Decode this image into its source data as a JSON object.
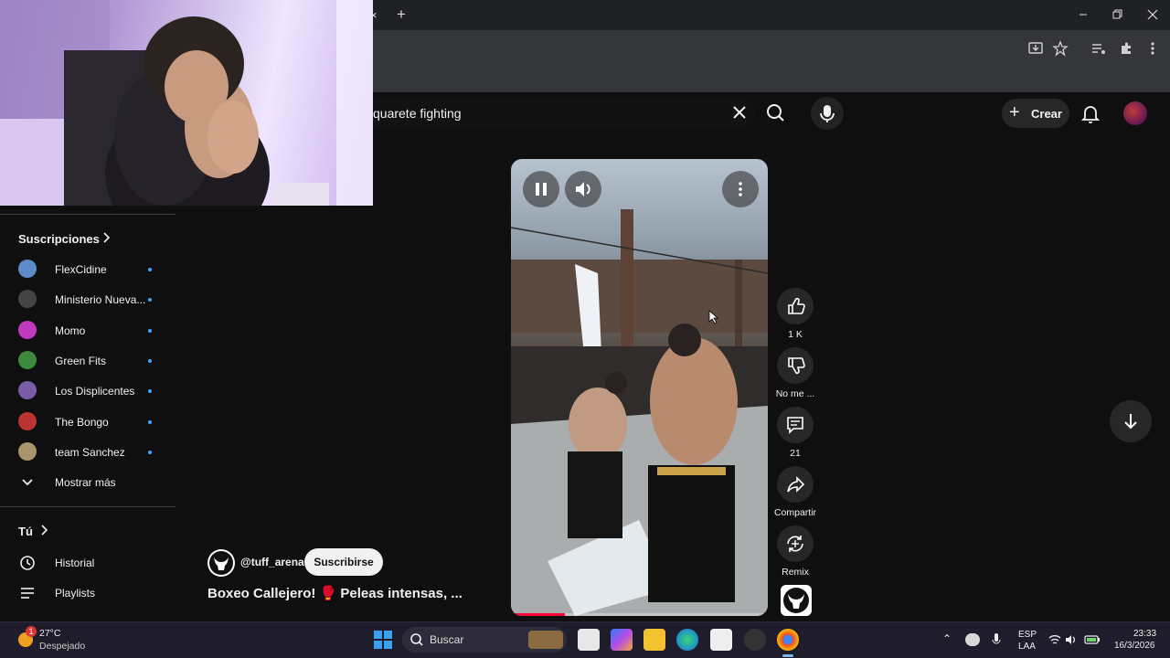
{
  "browser": {
    "new_tab_symbol": "+",
    "close_tab_symbol": "×",
    "window_controls": [
      "minimize-icon",
      "restore-icon",
      "close-icon"
    ],
    "toolbar_icons": [
      "install-app-icon",
      "bookmark-star-icon",
      "media-control-icon",
      "extensions-icon",
      "kebab-menu-icon"
    ]
  },
  "header": {
    "search_value": "quarete fighting",
    "create_label": "Crear"
  },
  "sidebar": {
    "subscriptions_label": "Suscripciones",
    "subscriptions": [
      {
        "name": "FlexCidine",
        "color": "#5b8cc7"
      },
      {
        "name": "Ministerio Nueva...",
        "color": "#444444"
      },
      {
        "name": "Momo",
        "color": "#c03ac0"
      },
      {
        "name": "Green Fits",
        "color": "#3d8a3d"
      },
      {
        "name": "Los Displicentes",
        "color": "#7a5ca8"
      },
      {
        "name": "The Bongo",
        "color": "#b33"
      },
      {
        "name": "team Sanchez",
        "color": "#a8956b"
      }
    ],
    "show_more_label": "Mostrar más",
    "you_label": "Tú",
    "history_label": "Historial",
    "playlists_label": "Playlists"
  },
  "short": {
    "channel_handle": "@tuff_arena",
    "subscribe_label": "Suscribirse",
    "title": "Boxeo Callejero! 🥊 Peleas intensas, ...",
    "progress": 0.21,
    "like_count": "1 K",
    "dislike_label": "No me ...",
    "comment_count": "21",
    "share_label": "Compartir",
    "remix_label": "Remix"
  },
  "taskbar": {
    "weather_temp": "27°C",
    "weather_desc": "Despejado",
    "weather_badge": "1",
    "search_label": "Buscar",
    "lang_line1": "ESP",
    "lang_line2": "LAA",
    "time": "23:33",
    "date": "16/3/2026"
  }
}
